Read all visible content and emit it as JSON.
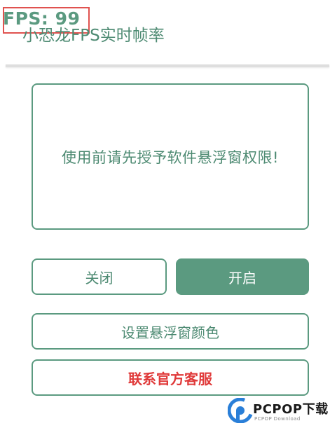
{
  "fps": {
    "label": "FPS: 99"
  },
  "header": {
    "title": "小恐龙FPS实时帧率"
  },
  "notice": {
    "text": "使用前请先授予软件悬浮窗权限!"
  },
  "buttons": {
    "close": "关闭",
    "open": "开启",
    "set_color": "设置悬浮窗颜色",
    "support": "联系官方客服"
  },
  "watermark": {
    "brand": "PCPOP下载",
    "sub": "PCPOP Download"
  },
  "colors": {
    "accent": "#5b9a80",
    "accent_dark": "#4d8a72",
    "danger": "#e03a3a",
    "fps_border": "#e0524f"
  },
  "icons": {
    "watermark_logo": "pcpop-logo-icon"
  }
}
